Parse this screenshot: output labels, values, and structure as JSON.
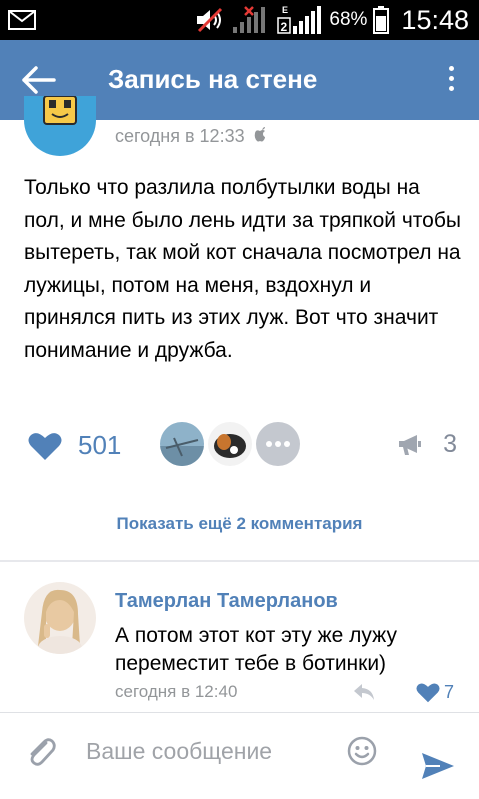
{
  "status_bar": {
    "battery": "68%",
    "time": "15:48",
    "network_badges": [
      "E",
      "2"
    ],
    "icons": [
      "mail-icon",
      "mute-icon",
      "no-signal-icon",
      "signal-icon",
      "battery-icon"
    ]
  },
  "app_bar": {
    "title": "Запись на стене",
    "icons": [
      "back-arrow-icon",
      "more-vertical-icon"
    ]
  },
  "post": {
    "time": "сегодня в 12:33",
    "device_icon": "apple-icon",
    "text": "Только что разлила полбутылки воды на пол, и мне было лень идти за тряпкой чтобы вытереть, так мой кот сначала посмотрел на лужицы, потом на меня, вздохнул и принялся пить из этих луж. Вот что значит понимание и дружба.",
    "likes": "501",
    "shares": "3",
    "icons": [
      "heart-icon",
      "megaphone-icon",
      "more-dots-icon"
    ]
  },
  "comments_section": {
    "show_more": "Показать ещё 2 комментария"
  },
  "comment": {
    "author": "Тамерлан Тамерланов",
    "text": "А потом этот кот эту же лужу переместит тебе в ботинки)",
    "time": "сегодня в 12:40",
    "likes": "7",
    "icons": [
      "reply-icon",
      "heart-icon"
    ]
  },
  "composer": {
    "placeholder": "Ваше сообщение",
    "icons": [
      "paperclip-icon",
      "smile-icon",
      "send-icon"
    ]
  },
  "colors": {
    "brand": "#5181b8",
    "muted": "#939699",
    "status_bar": "#000000"
  }
}
